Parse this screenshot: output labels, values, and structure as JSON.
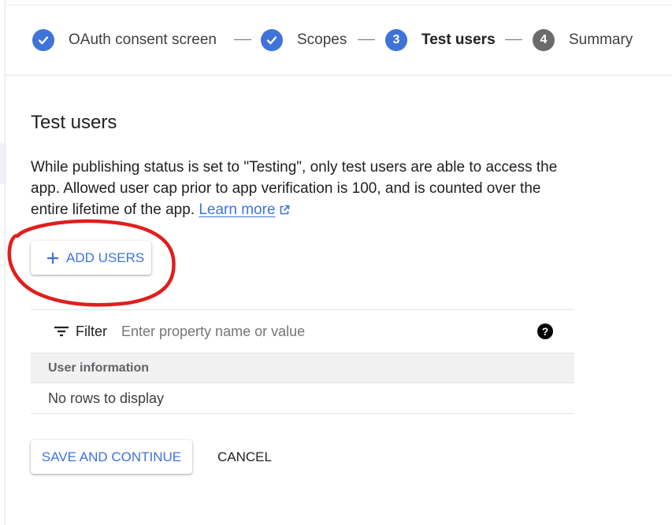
{
  "stepper": {
    "steps": [
      {
        "label": "OAuth consent screen",
        "state": "done"
      },
      {
        "label": "Scopes",
        "state": "done"
      },
      {
        "label": "Test users",
        "number": "3",
        "state": "active"
      },
      {
        "label": "Summary",
        "number": "4",
        "state": "todo"
      }
    ]
  },
  "section": {
    "title": "Test users",
    "description": "While publishing status is set to \"Testing\", only test users are able to access the app. Allowed user cap prior to app verification is 100, and is counted over the entire lifetime of the app.",
    "learn_more": "Learn more"
  },
  "add_users_label": "ADD USERS",
  "table": {
    "filter_label": "Filter",
    "filter_placeholder": "Enter property name or value",
    "help": "?",
    "column_header": "User information",
    "empty_message": "No rows to display"
  },
  "actions": {
    "save_label": "SAVE AND CONTINUE",
    "cancel_label": "CANCEL"
  },
  "colors": {
    "accent": "#3f73d9",
    "annotation": "#e01e1e"
  },
  "icons": [
    "check-icon",
    "plus-icon",
    "external-link-icon",
    "filter-icon",
    "help-icon"
  ]
}
